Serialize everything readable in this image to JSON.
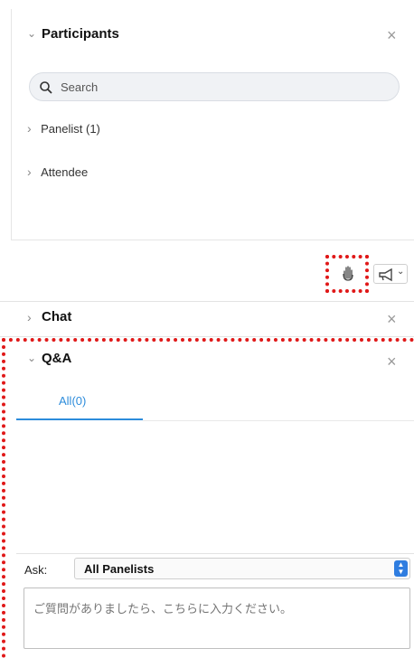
{
  "participants": {
    "title": "Participants",
    "search_placeholder": "Search",
    "items": [
      {
        "label": "Panelist (1)"
      },
      {
        "label": "Attendee"
      }
    ]
  },
  "chat": {
    "title": "Chat"
  },
  "qa": {
    "title": "Q&A",
    "tabs": [
      {
        "label": "All(0)",
        "active": true
      }
    ],
    "ask_label": "Ask:",
    "ask_selected": "All Panelists",
    "input_placeholder": "ご質問がありましたら、こちらに入力ください。"
  },
  "colors": {
    "highlight_border": "#e01818",
    "tab_active": "#2d8cdb",
    "select_accent": "#2f7de0"
  },
  "icons": {
    "raise_hand": "hand-icon",
    "announce": "megaphone-icon",
    "close": "close-icon",
    "chevron": "chevron-icon",
    "search": "search-icon"
  }
}
